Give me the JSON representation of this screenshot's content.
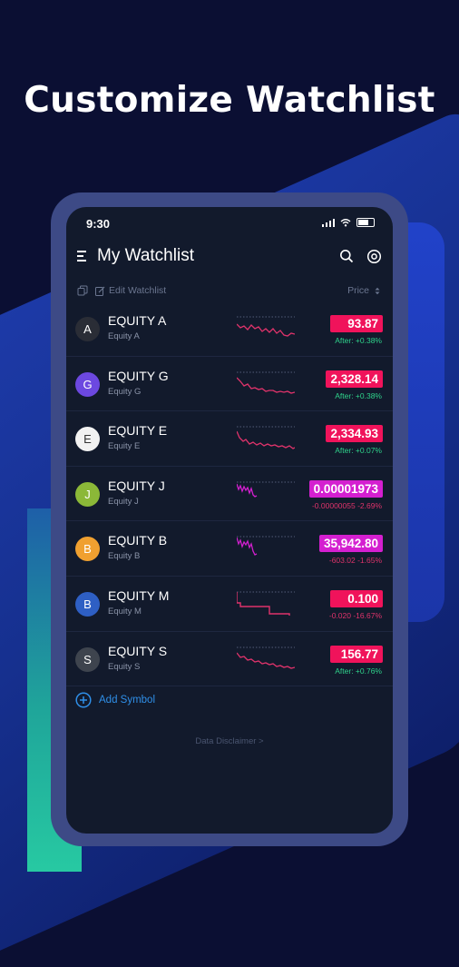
{
  "headline": "Customize Watchlist",
  "status": {
    "time": "9:30"
  },
  "header": {
    "title": "My Watchlist",
    "icons": [
      "menu-icon",
      "search-icon",
      "settings-icon"
    ]
  },
  "subbar": {
    "edit_label": "Edit Watchlist",
    "price_label": "Price"
  },
  "colors": {
    "background": "#0b0f33",
    "screen": "#121a2c",
    "price_red": "#f0135b",
    "price_magenta": "#d41fd0",
    "positive": "#2fd38b",
    "negative": "#e0336b",
    "link": "#2f8fe8"
  },
  "watchlist": [
    {
      "letter": "A",
      "name": "EQUITY A",
      "sub": "Equity A",
      "price": "93.87",
      "change": "After: +0.38%",
      "avatar_color": "#2a2d36"
    },
    {
      "letter": "G",
      "name": "EQUITY G",
      "sub": "Equity G",
      "price": "2,328.14",
      "change": "After: +0.38%",
      "avatar_color": "#6c48e0"
    },
    {
      "letter": "E",
      "name": "EQUITY E",
      "sub": "Equity E",
      "price": "2,334.93",
      "change": "After: +0.07%",
      "avatar_color": "#f2f2f2"
    },
    {
      "letter": "J",
      "name": "EQUITY J",
      "sub": "Equity J",
      "price": "0.00001973",
      "change": "-0.00000055 -2.69%",
      "avatar_color": "#8bb838"
    },
    {
      "letter": "B",
      "name": "EQUITY B",
      "sub": "Equity B",
      "price": "35,942.80",
      "change": "-603.02 -1.65%",
      "avatar_color": "#f0a030"
    },
    {
      "letter": "B",
      "name": "EQUITY M",
      "sub": "Equity M",
      "price": "0.100",
      "change": "-0.020 -16.67%",
      "avatar_color": "#2e5fc4"
    },
    {
      "letter": "S",
      "name": "EQUITY S",
      "sub": "Equity S",
      "price": "156.77",
      "change": "After: +0.76%",
      "avatar_color": "#3e444e"
    }
  ],
  "add_symbol": "Add Symbol",
  "disclaimer": "Data Disclaimer >"
}
